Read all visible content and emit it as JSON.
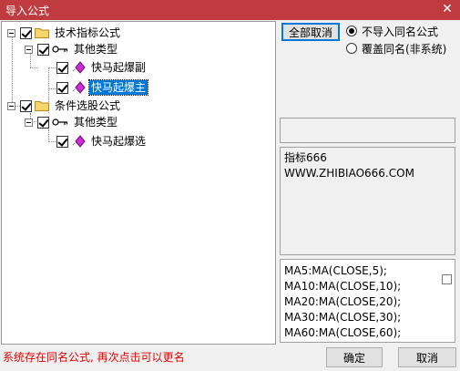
{
  "window": {
    "title": "导入公式",
    "close_glyph": "✕"
  },
  "tree": {
    "nodes": [
      {
        "label": "技术指标公式"
      },
      {
        "label": "其他类型"
      },
      {
        "label": "快马起爆副"
      },
      {
        "label": "快马起爆主",
        "selected": true
      },
      {
        "label": "条件选股公式"
      },
      {
        "label": "其他类型"
      },
      {
        "label": "快马起爆选"
      }
    ]
  },
  "controls": {
    "cancel_all_label": "全部取消",
    "radio_skip_label": "不导入同名公式",
    "radio_overwrite_label": "覆盖同名(非系统)",
    "selected_option": "不导入同名公式"
  },
  "info": {
    "line1": "指标666",
    "line2": "WWW.ZHIBIAO666.COM"
  },
  "code": {
    "lines": [
      "MA5:MA(CLOSE,5);",
      "MA10:MA(CLOSE,10);",
      "MA20:MA(CLOSE,20);",
      "MA30:MA(CLOSE,30);",
      "MA60:MA(CLOSE,60);"
    ]
  },
  "status": {
    "message": "系统存在同名公式, 再次点击可以更名"
  },
  "footer": {
    "ok_label": "确定",
    "cancel_label": "取消"
  },
  "colors": {
    "titlebar": "#bf3b3f",
    "selection": "#0078d7",
    "status_text": "#e00000"
  }
}
